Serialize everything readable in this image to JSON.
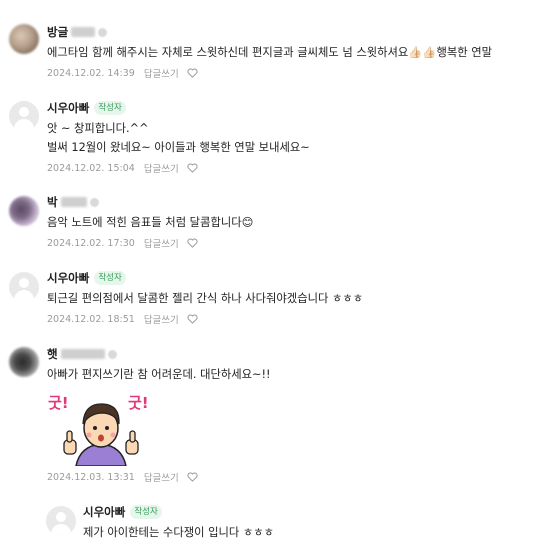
{
  "comments": [
    {
      "name": "방글",
      "is_writer": false,
      "lines": [
        "에그타임 함께 해주시는 자체로 스윗하신데 편지글과 글씨체도 넘 스윗하셔요👍🏻👍🏻행복한 연말"
      ],
      "date": "2024.12.02. 14:39",
      "reply_label": "답글쓰기"
    },
    {
      "name": "시우아빠",
      "is_writer": true,
      "writer_badge": "작성자",
      "lines": [
        "앗 ~ 창피합니다.^^",
        "벌써 12월이 왔네요~ 아이들과 행복한 연말 보내세요~"
      ],
      "date": "2024.12.02. 15:04",
      "reply_label": "답글쓰기"
    },
    {
      "name": "박",
      "is_writer": false,
      "lines": [
        "음악 노트에 적힌 음표들 처럼 달콤합니다😊"
      ],
      "date": "2024.12.02. 17:30",
      "reply_label": "답글쓰기"
    },
    {
      "name": "시우아빠",
      "is_writer": true,
      "writer_badge": "작성자",
      "lines": [
        "퇴근길 편의점에서 달콤한 젤리 간식 하나 사다줘야겠습니다 ㅎㅎㅎ"
      ],
      "date": "2024.12.02. 18:51",
      "reply_label": "답글쓰기"
    },
    {
      "name": "햇",
      "is_writer": false,
      "lines": [
        "아빠가 편지쓰기란 참 어려운데. 대단하세요~!!"
      ],
      "sticker_text_left": "굿!",
      "sticker_text_right": "굿!",
      "date": "2024.12.03. 13:31",
      "reply_label": "답글쓰기"
    },
    {
      "name": "시우아빠",
      "is_writer": true,
      "writer_badge": "작성자",
      "lines": [
        "제가 아이한테는 수다쟁이 입니다 ㅎㅎㅎ"
      ]
    }
  ],
  "colors": {
    "writer_badge_text": "#3aa05d",
    "writer_badge_bg": "#e7f6ec",
    "meta_text": "#9b9b9b"
  },
  "icons": {
    "like": "heart-outline-icon",
    "default_avatar": "default-profile-icon"
  }
}
